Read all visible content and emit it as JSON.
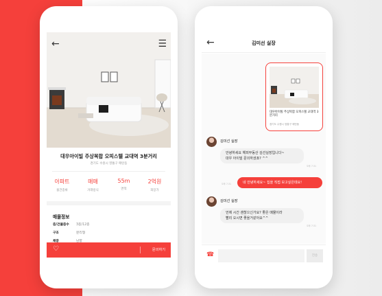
{
  "listing": {
    "title": "대우아이빌 주상복합 오피스텔 교대역 3분거리",
    "address": "경기도 수원시 영통구 매탄동",
    "stats": [
      {
        "value": "아파트",
        "label": "물건종류"
      },
      {
        "value": "매매",
        "label": "거래방식"
      },
      {
        "value": "55m",
        "label": "면적"
      },
      {
        "value": "2억원",
        "label": "희망가"
      }
    ],
    "section_title": "매물정보",
    "info": [
      {
        "key": "층/건물층수",
        "value": "3층/12층"
      },
      {
        "key": "구조",
        "value": "분리형"
      },
      {
        "key": "채광",
        "value": "남향"
      }
    ],
    "inquire_label": "문의하기"
  },
  "chat": {
    "title": "김미선 실장",
    "card": {
      "title": "대우아이빌 주상복합 오피스텔 교대역 3분거리",
      "address": "경기도 수원시 영통구 매탄동"
    },
    "messages": [
      {
        "sender": "김미선 실장",
        "lines": [
          "안녕하세요 해피부동산 김선실장입니다~",
          "대우 아이빌 문의하셨죠? ^^"
        ],
        "time": "오후 7:31"
      },
      {
        "text": "네 안녕하세요~ 집을 직접 보고싶은데요!",
        "time": "오후 7:31"
      },
      {
        "sender": "김미선 실장",
        "lines": [
          "언제 시간 괜찮으신가요? 좋은 매물이라",
          "빨리 오시면 좋을거같아요^^"
        ],
        "time": "오후 7:31"
      }
    ],
    "send_label": "전송"
  },
  "colors": {
    "accent": "#f5403b"
  },
  "icons": [
    "back-arrow-icon",
    "menu-icon",
    "heart-icon",
    "phone-icon",
    "avatar"
  ]
}
